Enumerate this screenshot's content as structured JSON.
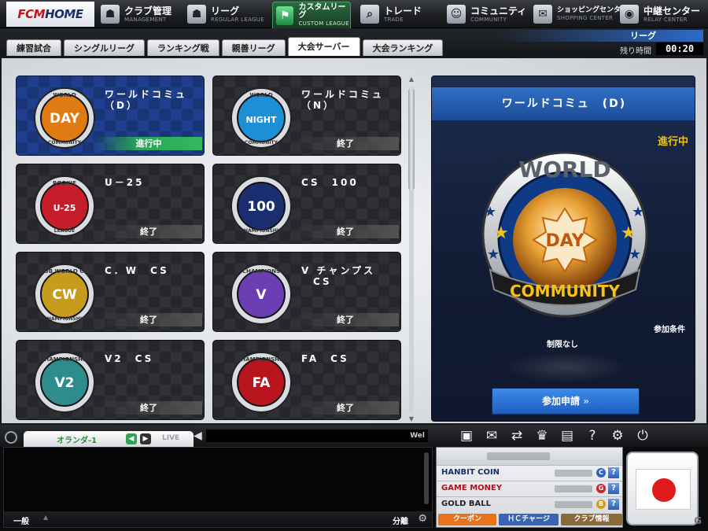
{
  "logo": {
    "main": "FCM",
    "sub": "HOME"
  },
  "nav": [
    {
      "jp": "クラブ管理",
      "en": "MANAGEMENT",
      "icon": "club-icon"
    },
    {
      "jp": "リーグ",
      "en": "REGULAR LEAGUE",
      "icon": "league-icon"
    },
    {
      "jp": "カスタムリーグ",
      "en": "CUSTOM LEAGUE",
      "icon": "flag-icon"
    },
    {
      "jp": "トレード",
      "en": "TRADE",
      "icon": "search-icon"
    },
    {
      "jp": "コミュニティ",
      "en": "COMMUNITY",
      "icon": "community-icon"
    },
    {
      "jp": "ショッピングセンター",
      "en": "SHOPPING CENTER",
      "icon": "shop-icon"
    },
    {
      "jp": "中継センター",
      "en": "RELAY CENTER",
      "icon": "relay-icon"
    }
  ],
  "tabs": [
    "練習試合",
    "シングルリーグ",
    "ランキング戦",
    "親善リーグ",
    "大会サーバー",
    "大会ランキング"
  ],
  "league": {
    "title": "リーグ",
    "remaining_label": "残り時間",
    "remaining": "00:20"
  },
  "cards": [
    {
      "name": "ワールドコミュ\n（D）",
      "status": "進行中",
      "badge_top": "WORLD",
      "badge_mid": "DAY",
      "badge_bottom": "COMMUNITY",
      "color": "#e07a12"
    },
    {
      "name": "ワールドコミュ\n（N）",
      "status": "終了",
      "badge_top": "WORLD",
      "badge_mid": "NIGHT",
      "badge_bottom": "COMMUNITY",
      "color": "#1c8fd6"
    },
    {
      "name": "U－25",
      "status": "終了",
      "badge_top": "ROOKIE",
      "badge_mid": "U-25",
      "badge_bottom": "LEAGUE",
      "color": "#c71d2a"
    },
    {
      "name": "CS　100",
      "status": "終了",
      "badge_top": "",
      "badge_mid": "100",
      "badge_bottom": "CHAMPIONSHIP",
      "color": "#1a2e70"
    },
    {
      "name": "C．W　CS",
      "status": "終了",
      "badge_top": "CLUB WORLD CUP",
      "badge_mid": "CW",
      "badge_bottom": "CHAMPIONSHIP",
      "color": "#c79b1e"
    },
    {
      "name": "V チャンプス\n　CS",
      "status": "終了",
      "badge_top": "CHAMPIONS",
      "badge_mid": "V",
      "badge_bottom": "",
      "color": "#6b3fb3"
    },
    {
      "name": "V2　CS",
      "status": "終了",
      "badge_top": "CHAMPIONSHIP",
      "badge_mid": "V2",
      "badge_bottom": "",
      "color": "#2f8c8c"
    },
    {
      "name": "FA　CS",
      "status": "終了",
      "badge_top": "CHAMPIONSHIP",
      "badge_mid": "FA",
      "badge_bottom": "",
      "color": "#b8141e"
    }
  ],
  "detail": {
    "title": "ワールドコミュ　(D)",
    "status": "進行中",
    "badge_top": "WORLD",
    "badge_mid": "DAY",
    "badge_bottom": "COMMUNITY",
    "condition_label": "参加条件",
    "condition_value": "制限なし",
    "apply_label": "参加申請"
  },
  "chat": {
    "channel": "オランダ-1",
    "live": "LIVE",
    "ticker": "Wel",
    "general": "一般",
    "split": "分離"
  },
  "currency": [
    {
      "label": "HANBIT COIN",
      "symbol": "C",
      "color": "#1b2f66",
      "sym_color": "#2c64c4"
    },
    {
      "label": "GAME MONEY",
      "symbol": "G",
      "color": "#b0141b",
      "sym_color": "#c7262d"
    },
    {
      "label": "GOLD BALL",
      "symbol": "B",
      "color": "#222222",
      "sym_color": "#d89a16"
    }
  ],
  "currency_buttons": [
    {
      "label": "クーポン",
      "color": "#e8731c"
    },
    {
      "label": "ＨＣチャージ",
      "color": "#3a63b3"
    },
    {
      "label": "クラブ情報",
      "color": "#8a6a3a"
    }
  ],
  "watermark": "G"
}
